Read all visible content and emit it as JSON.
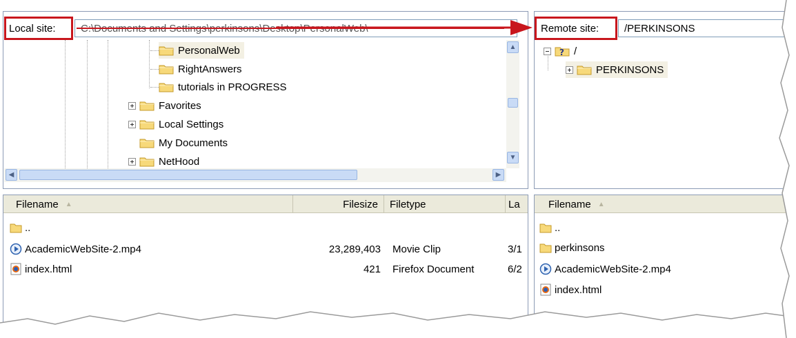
{
  "local_site": {
    "label": "Local site:",
    "path": "C:\\Documents and Settings\\perkinsons\\Desktop\\PersonalWeb\\",
    "tree": [
      {
        "label": "PersonalWeb",
        "expander": "none",
        "selected": true
      },
      {
        "label": "RightAnswers",
        "expander": "none"
      },
      {
        "label": "tutorials in PROGRESS",
        "expander": "none"
      },
      {
        "label": "Favorites",
        "expander": "plus"
      },
      {
        "label": "Local Settings",
        "expander": "plus"
      },
      {
        "label": "My Documents",
        "expander": "none"
      },
      {
        "label": "NetHood",
        "expander": "plus"
      }
    ]
  },
  "remote_site": {
    "label": "Remote site:",
    "path": "/PERKINSONS",
    "tree": [
      {
        "label": "/",
        "expander": "minus",
        "icon": "question-folder-icon"
      },
      {
        "label": "PERKINSONS",
        "expander": "plus",
        "icon": "folder-icon"
      }
    ]
  },
  "local_files": {
    "columns": {
      "filename": "Filename",
      "filesize": "Filesize",
      "filetype": "Filetype",
      "last": "La"
    },
    "rows": [
      {
        "name": "..",
        "size": "",
        "type": "",
        "date": "",
        "icon": "folder-icon"
      },
      {
        "name": "AcademicWebSite-2.mp4",
        "size": "23,289,403",
        "type": "Movie Clip",
        "date": "3/1",
        "icon": "media-file-icon"
      },
      {
        "name": "index.html",
        "size": "421",
        "type": "Firefox Document",
        "date": "6/2",
        "icon": "firefox-file-icon"
      }
    ]
  },
  "remote_files": {
    "columns": {
      "filename": "Filename"
    },
    "rows": [
      {
        "name": "..",
        "icon": "folder-icon"
      },
      {
        "name": "perkinsons",
        "icon": "folder-icon"
      },
      {
        "name": "AcademicWebSite-2.mp4",
        "icon": "media-file-icon"
      },
      {
        "name": "index.html",
        "icon": "firefox-file-icon"
      }
    ]
  },
  "colors": {
    "highlight_red": "#c8161d",
    "panel_border": "#8c9bb5",
    "header_bg": "#ebeadb",
    "selected_bg": "#f3f0e3"
  }
}
